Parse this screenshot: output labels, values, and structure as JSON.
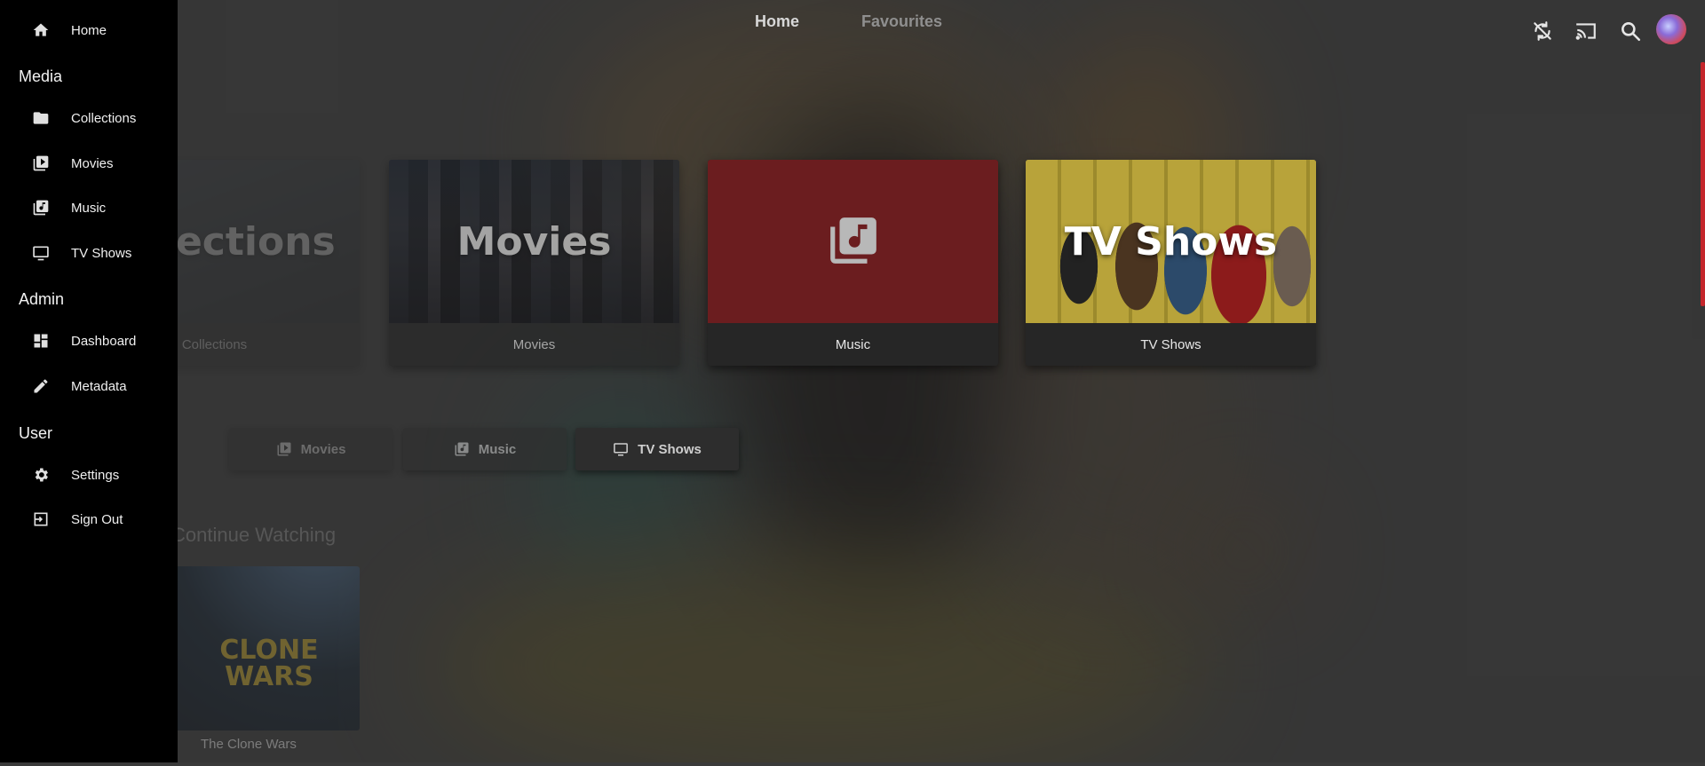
{
  "topnav": {
    "tabs": [
      "Home",
      "Favourites"
    ]
  },
  "sidebar": {
    "home": "Home",
    "sections": [
      {
        "header": "Media",
        "items": [
          "Collections",
          "Movies",
          "Music",
          "TV Shows"
        ]
      },
      {
        "header": "Admin",
        "items": [
          "Dashboard",
          "Metadata"
        ]
      },
      {
        "header": "User",
        "items": [
          "Settings",
          "Sign Out"
        ]
      }
    ]
  },
  "libraries": [
    {
      "overlay": "Collections",
      "label": "Collections"
    },
    {
      "overlay": "Movies",
      "label": "Movies"
    },
    {
      "overlay": "",
      "label": "Music"
    },
    {
      "overlay": "TV Shows",
      "label": "TV Shows"
    }
  ],
  "quick_buttons": [
    "Movies",
    "Music",
    "TV Shows"
  ],
  "continue_watching": {
    "title": "Continue Watching",
    "items": [
      {
        "label": "The Clone Wars",
        "logo": "CLONE WARS"
      }
    ]
  },
  "colors": {
    "accent": "#c4262b",
    "music_tile": "#6b1d1f",
    "sidebar_bg": "#000000"
  },
  "icons": [
    "sync-disabled-icon",
    "cast-icon",
    "search-icon",
    "avatar"
  ]
}
